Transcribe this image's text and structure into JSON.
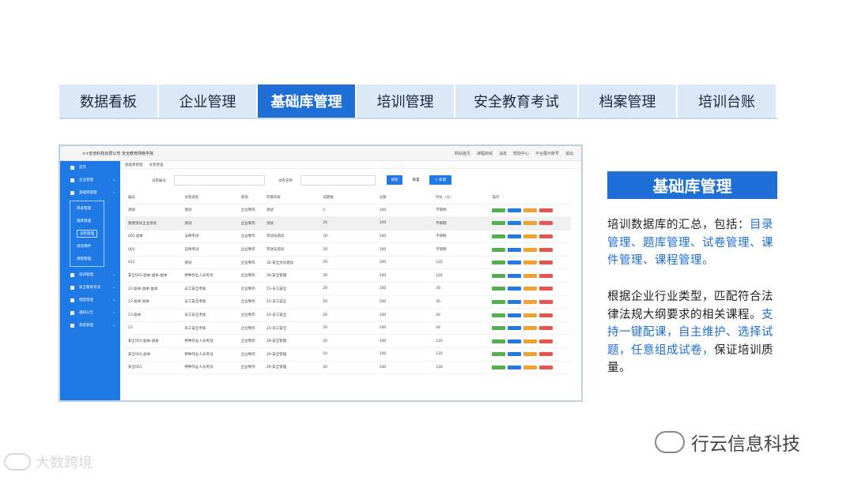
{
  "tabs": [
    {
      "label": "数据看板",
      "width": 126
    },
    {
      "label": "企业管理",
      "width": 125
    },
    {
      "label": "基础库管理",
      "width": 125,
      "active": true
    },
    {
      "label": "培训管理",
      "width": 125
    },
    {
      "label": "安全教育考试",
      "width": 156
    },
    {
      "label": "档案管理",
      "width": 125
    },
    {
      "label": "培训台账",
      "width": 126
    }
  ],
  "app": {
    "header_title": "××安培科技有限公司 安全教育网络学院",
    "header_right": [
      "网站首页",
      "课程商城",
      "消息",
      "帮助中心",
      "平台展示账号",
      "退出"
    ],
    "sidebar": [
      {
        "label": "首页"
      },
      {
        "label": "企业管理"
      },
      {
        "label": "基础库管理"
      },
      {
        "label": "培训管理"
      },
      {
        "label": "安全教育考试"
      },
      {
        "label": "档案管理"
      },
      {
        "label": "通知公告"
      },
      {
        "label": "系统管理"
      }
    ],
    "sidebar_sub": [
      "目录管理",
      "题库管理",
      "试卷管理",
      "培训课件",
      "课程管理"
    ],
    "breadcrumb": [
      "基础库管理",
      "试卷管理"
    ],
    "filter_code_label": "试卷编号",
    "filter_name_label": "试卷名称",
    "btn_search": "搜索",
    "btn_reset": "重置",
    "btn_new": "+ 新建",
    "table_headers": [
      "编号",
      "试卷类别",
      "来源",
      "所属目录",
      "试题数",
      "分数",
      "时长（分）",
      "操作"
    ],
    "rows": [
      [
        "测试",
        "测试",
        "企业制作",
        "测试",
        "5",
        "100",
        "不限制"
      ],
      [
        "随便测试企业测试",
        "测试",
        "企业制作",
        "测试",
        "20",
        "100",
        "不限制"
      ],
      [
        "001 副本",
        "法律考试",
        "企业制作",
        "劳动法培训",
        "20",
        "100",
        "不限制"
      ],
      [
        "001",
        "法律考试",
        "企业制作",
        "劳动法培训",
        "20",
        "100",
        "不限制"
      ],
      [
        "012",
        "测试",
        "企业制作",
        "32-安全文化建设",
        "20",
        "100",
        "120"
      ],
      [
        "安全001-副本-副本-副本",
        "特种作业人员考试",
        "企业制作",
        "29-安全管理",
        "20",
        "100",
        "120"
      ],
      [
        "23-副本-副本-副本",
        "员工安全考核",
        "企业制作",
        "23-员工安全",
        "20",
        "100",
        "30"
      ],
      [
        "23-副本-副本",
        "员工安全考核",
        "企业制作",
        "23-员工安全",
        "20",
        "100",
        "30"
      ],
      [
        "23-副本",
        "员工安全考核",
        "企业制作",
        "23-员工安全",
        "20",
        "100",
        "30"
      ],
      [
        "23",
        "员工安全考核",
        "企业制作",
        "23-员工安全",
        "20",
        "100",
        "30"
      ],
      [
        "安全001-副本-副本",
        "特种作业人员考试",
        "企业制作",
        "29-安全管理",
        "20",
        "100",
        "120"
      ],
      [
        "安全001-副本",
        "特种作业人员考试",
        "企业制作",
        "29-安全管理",
        "20",
        "100",
        "120"
      ],
      [
        "安全001",
        "特种作业人员考试",
        "企业制作",
        "29-安全管理",
        "20",
        "100",
        "120"
      ]
    ],
    "row_ops": [
      "查看",
      "编辑",
      "复制试卷",
      "删除"
    ]
  },
  "right": {
    "title": "基础库管理",
    "p1_a": "培训数据库的汇总，包括：",
    "p1_b": "目录管理、题库管理、试卷管理、课件管理、课程管理。",
    "p2_a": "根据企业行业类型，匹配符合法律法规大纲要求的相关课程。",
    "p2_b": "支持一键配课，自主维护、选择试题，任意组成试卷，",
    "p2_c": "保证培训质量。"
  },
  "watermark_left": "大数跨境",
  "watermark_right": "行云信息科技"
}
